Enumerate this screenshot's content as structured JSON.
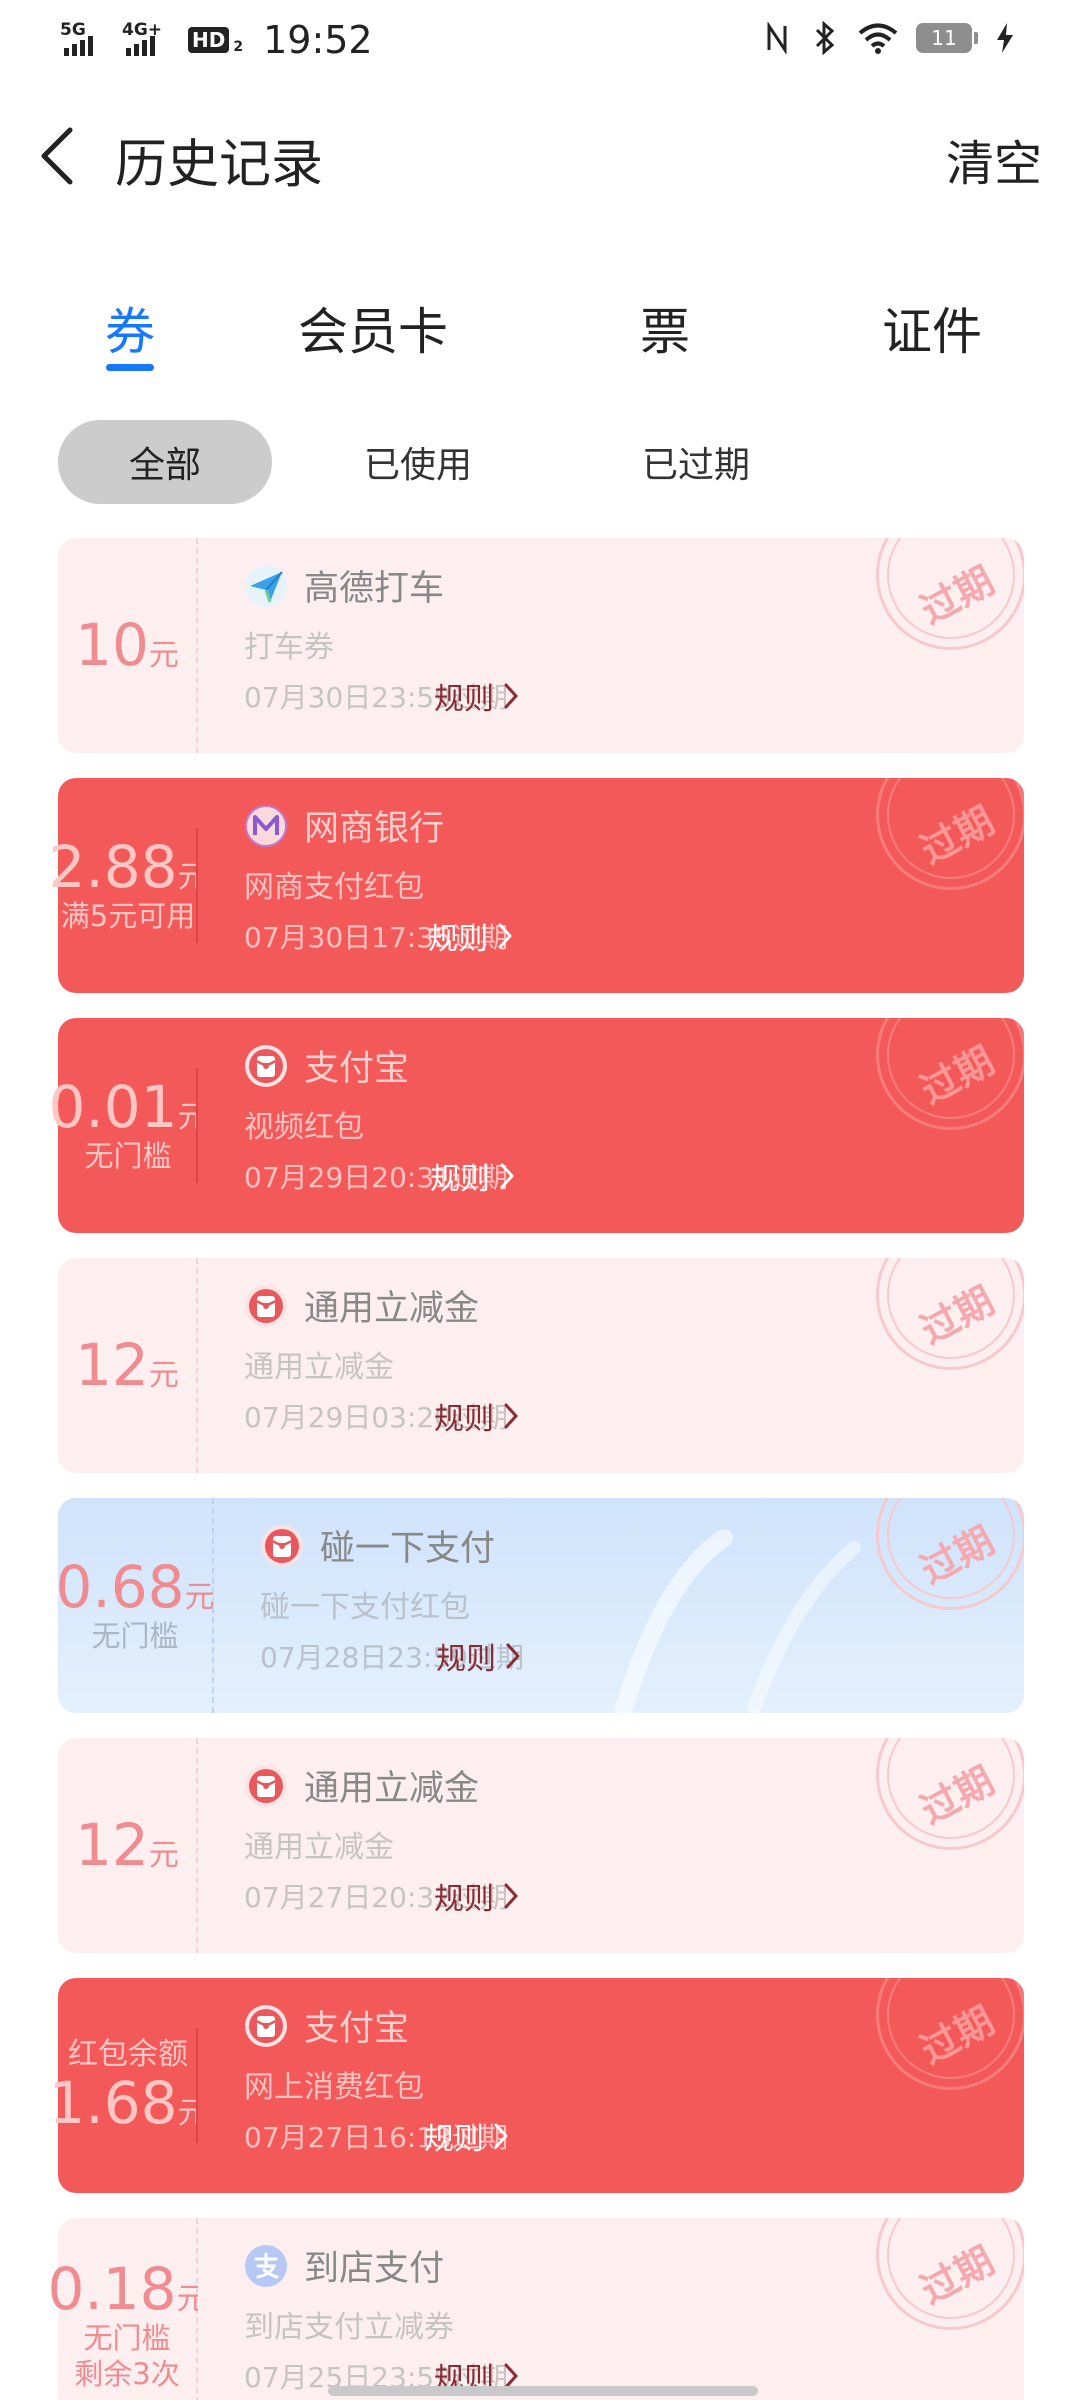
{
  "status_bar": {
    "signal1_label": "5G",
    "signal2_label": "4G+",
    "hd_label": "HD",
    "hd_sub": "2",
    "time": "19:52",
    "battery": "11"
  },
  "header": {
    "title": "历史记录",
    "clear_label": "清空"
  },
  "tabs": [
    {
      "label": "券",
      "active": true
    },
    {
      "label": "会员卡",
      "active": false
    },
    {
      "label": "票",
      "active": false
    },
    {
      "label": "证件",
      "active": false
    }
  ],
  "filters": [
    {
      "label": "全部",
      "active": true
    },
    {
      "label": "已使用",
      "active": false
    },
    {
      "label": "已过期",
      "active": false
    }
  ],
  "stamp_text": "过期",
  "rule_label": "规则",
  "colors": {
    "accent_blue": "#1677ff",
    "card_red": "#f4595a",
    "card_pink": "#fdeff0",
    "card_blue": "#cfe3fb"
  },
  "coupons": [
    {
      "theme": "pink",
      "pre": "",
      "amount": "10",
      "unit": "元",
      "conditions": [],
      "logo_icon": "paper-plane-icon",
      "merchant": "高德打车",
      "title": "打车券",
      "expire": "07月30日23:59过期"
    },
    {
      "theme": "red",
      "pre": "",
      "amount": "2.88",
      "unit": "元",
      "conditions": [
        "满5元可用"
      ],
      "logo_icon": "mybank-m-icon",
      "merchant": "网商银行",
      "title": "网商支付红包",
      "expire": "07月30日17:35过期"
    },
    {
      "theme": "red",
      "pre": "",
      "amount": "0.01",
      "unit": "元",
      "conditions": [
        "无门槛"
      ],
      "logo_icon": "red-packet-icon",
      "merchant": "支付宝",
      "title": "视频红包",
      "expire": "07月29日20:31过期"
    },
    {
      "theme": "pink",
      "pre": "",
      "amount": "12",
      "unit": "元",
      "conditions": [],
      "logo_icon": "red-packet-icon",
      "merchant": "通用立减金",
      "title": "通用立减金",
      "expire": "07月29日03:20过期"
    },
    {
      "theme": "blue",
      "pre": "",
      "amount": "0.68",
      "unit": "元",
      "conditions": [
        "无门槛"
      ],
      "logo_icon": "red-packet-icon",
      "merchant": "碰一下支付",
      "title": "碰一下支付红包",
      "expire": "07月28日23:59过期"
    },
    {
      "theme": "pink",
      "pre": "",
      "amount": "12",
      "unit": "元",
      "conditions": [],
      "logo_icon": "red-packet-icon",
      "merchant": "通用立减金",
      "title": "通用立减金",
      "expire": "07月27日20:32过期"
    },
    {
      "theme": "red",
      "pre": "红包余额",
      "amount": "1.68",
      "unit": "元",
      "conditions": [],
      "logo_icon": "red-packet-icon",
      "merchant": "支付宝",
      "title": "网上消费红包",
      "expire": "07月27日16:13过期"
    },
    {
      "theme": "pink",
      "pre": "",
      "amount": "0.18",
      "unit": "元",
      "conditions": [
        "无门槛",
        "剩余3次"
      ],
      "logo_icon": "alipay-icon",
      "merchant": "到店支付",
      "title": "到店支付立减券",
      "expire": "07月25日23:59过期"
    }
  ]
}
